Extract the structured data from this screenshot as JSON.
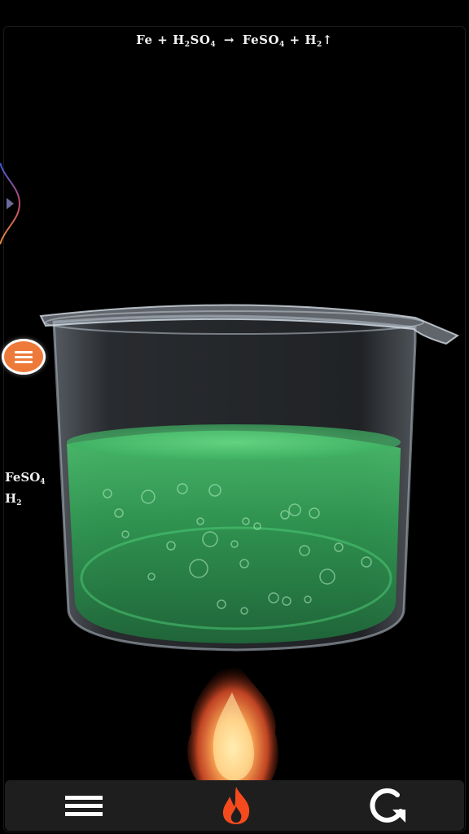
{
  "equation": {
    "reactant1": "Fe",
    "plus1": "+",
    "reactant2_a": "H",
    "reactant2_sub1": "2",
    "reactant2_b": "SO",
    "reactant2_sub2": "4",
    "arrow": "→",
    "product1_a": "FeSO",
    "product1_sub": "4",
    "plus2": "+",
    "product2_a": "H",
    "product2_sub": "2",
    "gas_arrow": "↑"
  },
  "products_panel": {
    "line1_a": "FeSO",
    "line1_sub": "4",
    "line2_a": "H",
    "line2_sub": "2"
  },
  "icons": {
    "side_tab": "chevron-right-icon",
    "menu_fab": "menu-icon",
    "bottom_menu": "hamburger-icon",
    "bottom_heat": "flame-icon",
    "bottom_reset": "refresh-icon"
  },
  "colors": {
    "fab": "#ee7a3a",
    "liquid": "#3fae5f",
    "flame": "#ff5a1f",
    "bar": "#1e1e1e"
  }
}
